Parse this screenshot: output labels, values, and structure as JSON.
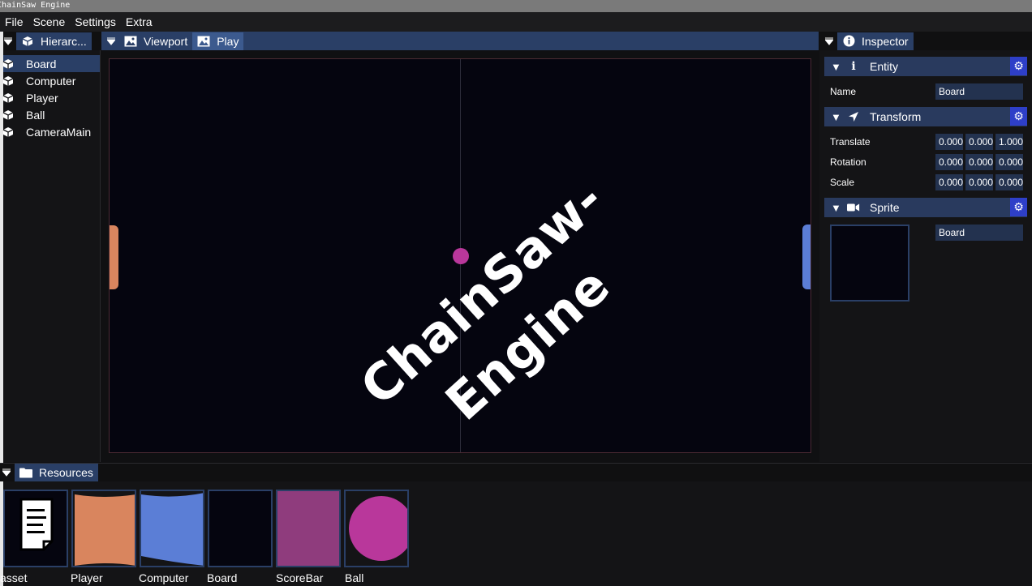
{
  "window": {
    "title": "ChainSaw Engine"
  },
  "menu": [
    "File",
    "Scene",
    "Settings",
    "Extra"
  ],
  "hierarchy": {
    "tab_label": "Hierarc...",
    "items": [
      "Board",
      "Computer",
      "Player",
      "Ball",
      "CameraMain"
    ],
    "selected": "Board"
  },
  "viewport": {
    "tabs": [
      "Viewport",
      "Play"
    ],
    "active_tab": "Play",
    "watermark": {
      "line1": "ChainSaw-",
      "line2": "Engine"
    },
    "colors": {
      "left_paddle": "#d9855e",
      "right_paddle": "#5b7ed6",
      "ball": "#b9379b",
      "background": "#05050f"
    }
  },
  "inspector": {
    "tab_label": "Inspector",
    "entity": {
      "header": "Entity",
      "name_label": "Name",
      "name_value": "Board"
    },
    "transform": {
      "header": "Transform",
      "translate_label": "Translate",
      "translate": [
        "0.000",
        "0.000",
        "1.000"
      ],
      "rotation_label": "Rotation",
      "rotation": [
        "0.000",
        "0.000",
        "0.000"
      ],
      "scale_label": "Scale",
      "scale": [
        "0.000",
        "0.000",
        "0.000"
      ]
    },
    "sprite": {
      "header": "Sprite",
      "texture_value": "Board"
    }
  },
  "resources": {
    "tab_label": "Resources",
    "items": [
      {
        "label": "asset",
        "color": "#ffffff",
        "icon": "document-icon"
      },
      {
        "label": "Player",
        "color": "#d9855e",
        "icon": "texture-icon"
      },
      {
        "label": "Computer",
        "color": "#5b7ed6",
        "icon": "texture-icon"
      },
      {
        "label": "Board",
        "color": "#05050f",
        "icon": "texture-icon"
      },
      {
        "label": "ScoreBar",
        "color": "#8f3c7d",
        "icon": "texture-icon"
      },
      {
        "label": "Ball",
        "color": "#b9379b",
        "icon": "texture-icon"
      }
    ]
  },
  "accent": {
    "tab_active": "#2a3f66",
    "gear_button": "#2e3fc8",
    "section_header": "#293a5e"
  }
}
